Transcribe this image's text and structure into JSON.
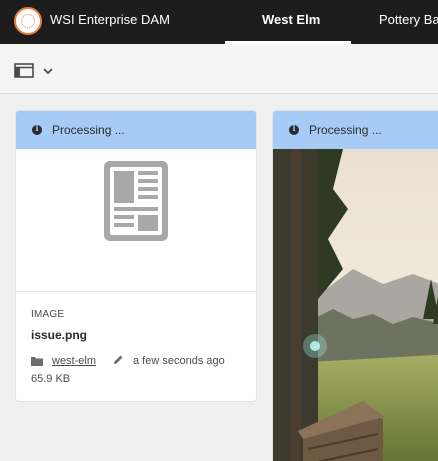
{
  "header": {
    "brand": "WSI Enterprise DAM",
    "tabs": [
      {
        "label": "West Elm",
        "active": true
      },
      {
        "label": "Pottery Barn",
        "active": false
      }
    ]
  },
  "toolbar": {
    "rail_toggle_icon": "sidebar-panel-icon",
    "dropdown_icon": "chevron-down-icon"
  },
  "cards": [
    {
      "status": "Processing ...",
      "status_icon": "info-icon",
      "thumbnail_icon": "document-icon",
      "type": "IMAGE",
      "name": "issue.png",
      "folder": "west-elm",
      "modified": "a few seconds ago",
      "size": "65.9 KB"
    },
    {
      "status": "Processing ...",
      "status_icon": "info-icon",
      "thumbnail": "landscape-photo"
    }
  ],
  "colors": {
    "topbar": "#1d1d1d",
    "status_bar": "#a6cbf6",
    "logo_accent": "#e87d3e"
  }
}
